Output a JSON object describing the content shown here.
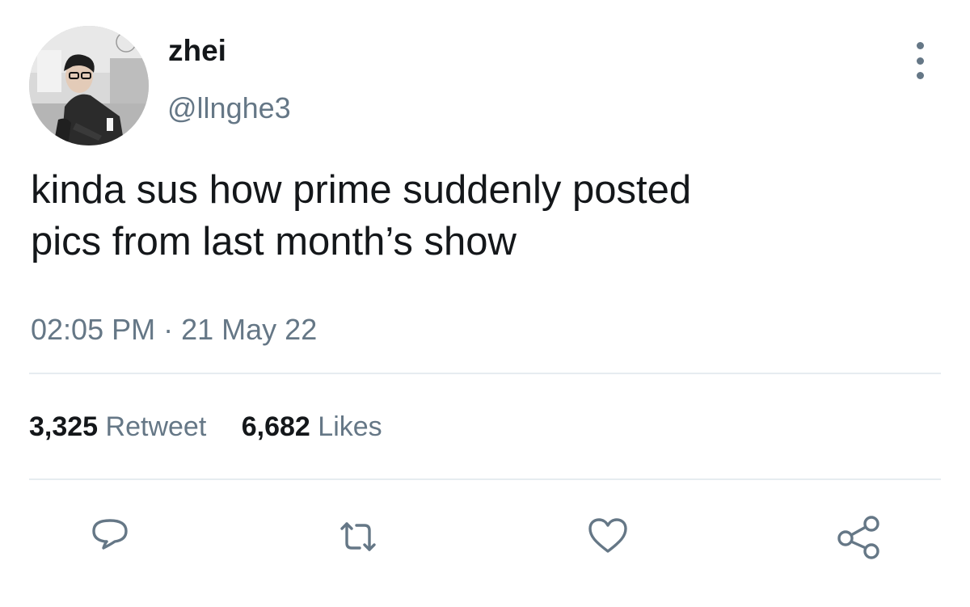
{
  "user": {
    "display_name": "zhei",
    "handle": "@llnghe3"
  },
  "tweet": {
    "text": "kinda sus how prime suddenly posted\npics from last month’s show",
    "time": "02:05 PM",
    "separator": "·",
    "date": "21 May 22"
  },
  "stats": {
    "retweets_count": "3,325",
    "retweets_label": "Retweet",
    "likes_count": "6,682",
    "likes_label": "Likes"
  },
  "colors": {
    "text": "#14171a",
    "secondary": "#657786",
    "divider": "#e6ecf0"
  },
  "icons": {
    "more": "more-vertical-icon",
    "reply": "reply-icon",
    "retweet": "retweet-icon",
    "like": "heart-icon",
    "share": "share-icon"
  }
}
